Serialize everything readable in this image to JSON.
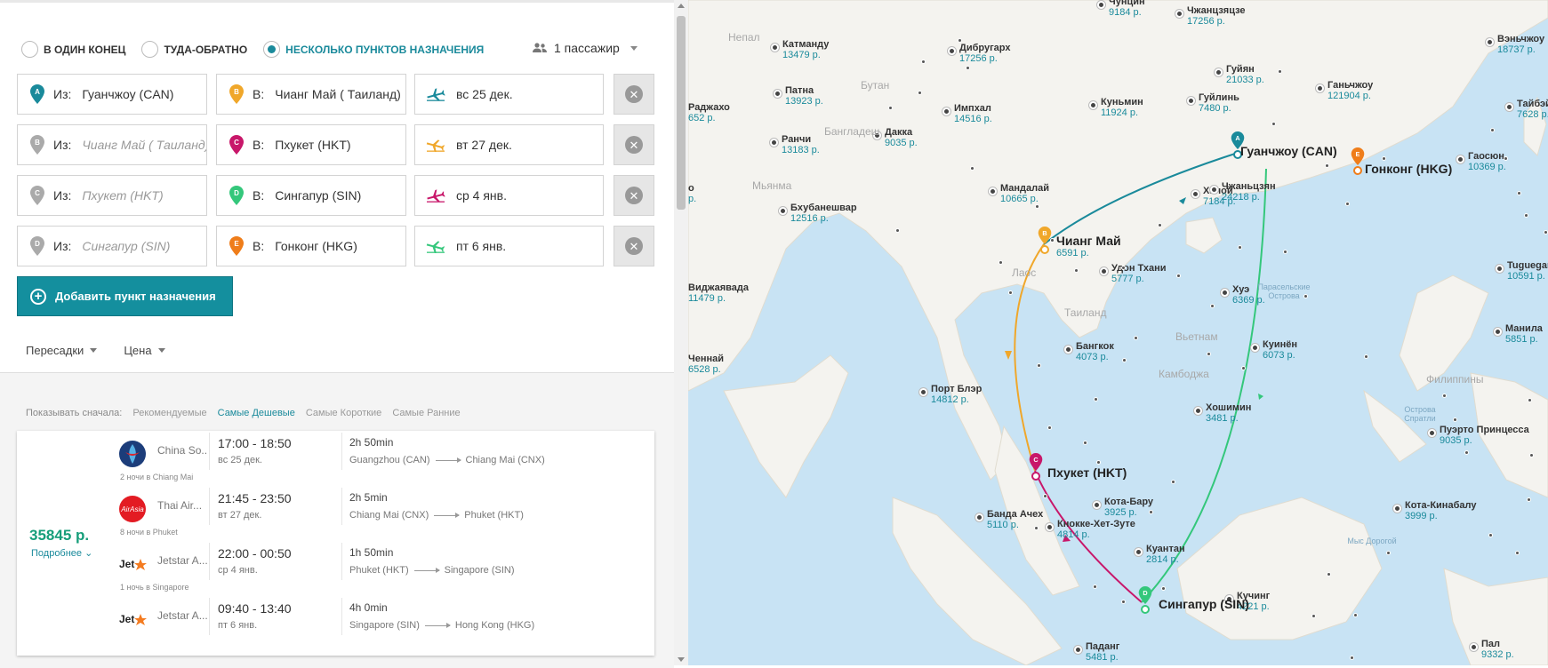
{
  "trip_types": [
    {
      "label": "В ОДИН КОНЕЦ",
      "selected": false
    },
    {
      "label": "ТУДА-ОБРАТНО",
      "selected": false
    },
    {
      "label": "НЕСКОЛЬКО ПУНКТОВ НАЗНАЧЕНИЯ",
      "selected": true
    }
  ],
  "passengers": "1 пассажир",
  "legs": [
    {
      "from_label": "Из:",
      "from": "Гуанчжоу (CAN)",
      "from_placeholder": false,
      "from_letter": "A",
      "from_color": "#1a8a9b",
      "to_label": "В:",
      "to": "Чианг Май ( Таиланд)",
      "to_letter": "B",
      "to_color": "#f0a72a",
      "date": "вс 25 дек.",
      "plane_color": "#1a8a9b"
    },
    {
      "from_label": "Из:",
      "from": "Чианг Май ( Таиланд)",
      "from_placeholder": true,
      "from_letter": "B",
      "from_color": "#aaaaaa",
      "to_label": "В:",
      "to": "Пхукет (HKT)",
      "to_letter": "C",
      "to_color": "#c8176a",
      "date": "вт 27 дек.",
      "plane_color": "#f0a72a"
    },
    {
      "from_label": "Из:",
      "from": "Пхукет (HKT)",
      "from_placeholder": true,
      "from_letter": "C",
      "from_color": "#aaaaaa",
      "to_label": "В:",
      "to": "Сингапур (SIN)",
      "to_letter": "D",
      "to_color": "#34c77b",
      "date": "ср 4 янв.",
      "plane_color": "#c8176a"
    },
    {
      "from_label": "Из:",
      "from": "Сингапур (SIN)",
      "from_placeholder": true,
      "from_letter": "D",
      "from_color": "#aaaaaa",
      "to_label": "В:",
      "to": "Гонконг (HKG)",
      "to_letter": "E",
      "to_color": "#ef7d1a",
      "date": "пт 6 янв.",
      "plane_color": "#34c77b"
    }
  ],
  "add_destination": "Добавить пункт назначения",
  "filters": [
    "Пересадки",
    "Цена"
  ],
  "sort": {
    "label": "Показывать сначала:",
    "options": [
      "Рекомендуемые",
      "Самые Дешевые",
      "Самые Короткие",
      "Самые Ранние"
    ],
    "active": 1
  },
  "result": {
    "price": "35845 р.",
    "more": "Подробнее",
    "segments": [
      {
        "airline": "China So...",
        "logo": "china-southern",
        "times": "17:00 - 18:50",
        "date": "вс 25 дек.",
        "duration": "2h 50min",
        "from": "Guangzhou (CAN)",
        "to": "Chiang Mai (CNX)",
        "stay": "2 ночи в Chiang Mai"
      },
      {
        "airline": "Thai Air...",
        "logo": "airasia",
        "times": "21:45 - 23:50",
        "date": "вт 27 дек.",
        "duration": "2h 5min",
        "from": "Chiang Mai (CNX)",
        "to": "Phuket (HKT)",
        "stay": "8 ночи в Phuket"
      },
      {
        "airline": "Jetstar A...",
        "logo": "jetstar",
        "times": "22:00 - 00:50",
        "date": "ср 4 янв.",
        "duration": "1h 50min",
        "from": "Phuket (HKT)",
        "to": "Singapore (SIN)",
        "stay": "1 ночь в Singapore"
      },
      {
        "airline": "Jetstar A...",
        "logo": "jetstar",
        "times": "09:40 - 13:40",
        "date": "пт 6 янв.",
        "duration": "4h 0min",
        "from": "Singapore (SIN)",
        "to": "Hong Kong (HKG)",
        "stay": ""
      }
    ]
  },
  "map": {
    "route_colors": {
      "A-B": "#1a8a9b",
      "B-C": "#f0a72a",
      "C-D": "#c8176a",
      "D-E": "#34c77b"
    },
    "main_cities": [
      {
        "letter": "A",
        "name": "Гуанчжоу (CAN)",
        "color": "#1a8a9b"
      },
      {
        "letter": "B",
        "name": "Чианг Май",
        "price": "6591 р.",
        "color": "#f0a72a"
      },
      {
        "letter": "C",
        "name": "Пхукет (HKT)",
        "color": "#c8176a"
      },
      {
        "letter": "D",
        "name": "Сингапур (SIN)",
        "color": "#34c77b"
      },
      {
        "letter": "E",
        "name": "Гонконг (HKG)",
        "color": "#ef7d1a"
      }
    ],
    "cities": [
      {
        "name": "Чунцин",
        "price": "9184 р."
      },
      {
        "name": "Чжанцзяцзе",
        "price": "17256 р."
      },
      {
        "name": "Вэньчжоу",
        "price": "18737 р."
      },
      {
        "name": "Катманду",
        "price": "13479 р."
      },
      {
        "name": "Дибругарх",
        "price": "17256 р."
      },
      {
        "name": "Гуйян",
        "price": "21033 р."
      },
      {
        "name": "Ганьчжоу",
        "price": "121904 р."
      },
      {
        "name": "Патна",
        "price": "13923 р."
      },
      {
        "name": "Импхал",
        "price": "14516 р."
      },
      {
        "name": "Куньмин",
        "price": "11924 р."
      },
      {
        "name": "Гуйлинь",
        "price": "7480 р."
      },
      {
        "name": "Тайбэй",
        "price": "7628 р."
      },
      {
        "name": "Ранчи",
        "price": "13183 р."
      },
      {
        "name": "Дакка",
        "price": "9035 р."
      },
      {
        "name": "Гаосюн",
        "price": "10369 р."
      },
      {
        "name": "Мандалай",
        "price": "10665 р."
      },
      {
        "name": "Ханой",
        "price": "7184 р."
      },
      {
        "name": "Чжаньцзян",
        "price": "24218 р."
      },
      {
        "name": "Бхубанешвар",
        "price": "12516 р."
      },
      {
        "name": "Удон Тхани",
        "price": "5777 р."
      },
      {
        "name": "Tuguegarao",
        "price": "10591 р."
      },
      {
        "name": "Виджаявада",
        "price": "11479 р."
      },
      {
        "name": "Хуэ",
        "price": "6369 р."
      },
      {
        "name": "Манила",
        "price": "5851 р."
      },
      {
        "name": "Бангкок",
        "price": "4073 р."
      },
      {
        "name": "Куинён",
        "price": "6073 р."
      },
      {
        "name": "Ченнай",
        "price": "6528 р."
      },
      {
        "name": "Порт Блэр",
        "price": "14812 р."
      },
      {
        "name": "Хошимин",
        "price": "3481 р."
      },
      {
        "name": "Пуэрто Принцесса",
        "price": "9035 р."
      },
      {
        "name": "Кота-Бару",
        "price": "3925 р."
      },
      {
        "name": "Банда Ачех",
        "price": "5110 р."
      },
      {
        "name": "Кота-Кинабалу",
        "price": "3999 р."
      },
      {
        "name": "Кнокке-Хет-Зуте",
        "price": "4814 р."
      },
      {
        "name": "Куантан",
        "price": "2814 р."
      },
      {
        "name": "Кучинг",
        "price": "4221 р."
      },
      {
        "name": "Паданг",
        "price": "5481 р."
      },
      {
        "name": "Пал",
        "price": "9332 р."
      },
      {
        "name": "Раджахо",
        "price": "652 р."
      },
      {
        "name": "о",
        "price": "р."
      }
    ],
    "countries": [
      "Непал",
      "Бутан",
      "Бангладеш",
      "Мьянма",
      "Таиланд",
      "Вьетнам",
      "Камбоджа",
      "Филиппины",
      "Лаос"
    ],
    "seas": [
      "Парасельские Острова",
      "Острова Спратли",
      "Мыс Дорогой"
    ]
  }
}
